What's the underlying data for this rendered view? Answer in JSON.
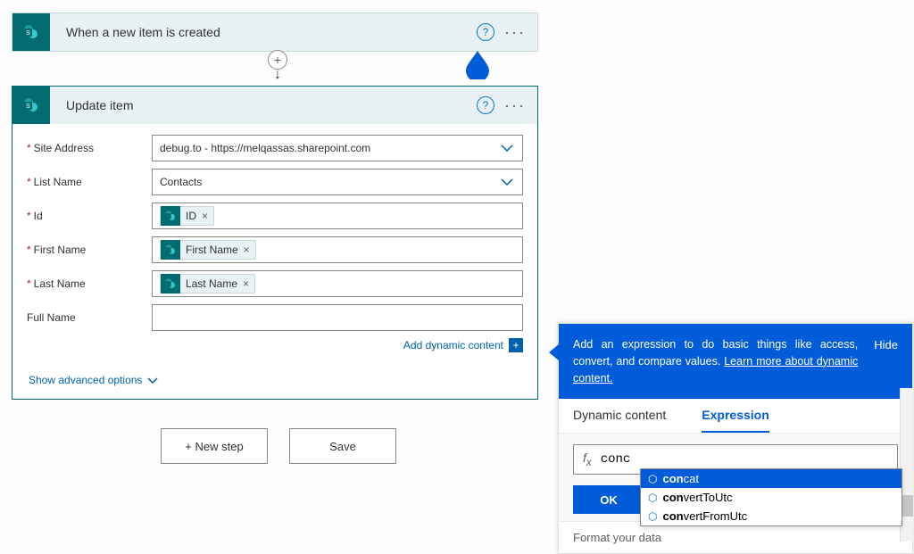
{
  "trigger": {
    "title": "When a new item is created"
  },
  "action": {
    "title": "Update item",
    "fields": {
      "siteAddress": {
        "label": "Site Address",
        "value": "debug.to - https://melqassas.sharepoint.com",
        "required": true
      },
      "listName": {
        "label": "List Name",
        "value": "Contacts",
        "required": true
      },
      "id": {
        "label": "Id",
        "token": "ID",
        "required": true
      },
      "firstName": {
        "label": "First Name",
        "token": "First Name",
        "required": true
      },
      "lastName": {
        "label": "Last Name",
        "token": "Last Name",
        "required": true
      },
      "fullName": {
        "label": "Full Name",
        "value": "",
        "required": false
      }
    },
    "addDynamic": "Add dynamic content",
    "showAdvanced": "Show advanced options"
  },
  "buttons": {
    "newStep": "+ New step",
    "save": "Save"
  },
  "panel": {
    "message": "Add an expression to do basic things like access, convert, and compare values. ",
    "learnMore": "Learn more about dynamic content.",
    "hide": "Hide",
    "tabs": {
      "dynamic": "Dynamic content",
      "expression": "Expression"
    },
    "input": "conc",
    "ok": "OK",
    "formatHeader": "Format your data",
    "suggestions": [
      {
        "prefix": "con",
        "rest": "cat",
        "selected": true
      },
      {
        "prefix": "con",
        "rest": "vertToUtc",
        "selected": false
      },
      {
        "prefix": "con",
        "rest": "vertFromUtc",
        "selected": false
      }
    ]
  }
}
